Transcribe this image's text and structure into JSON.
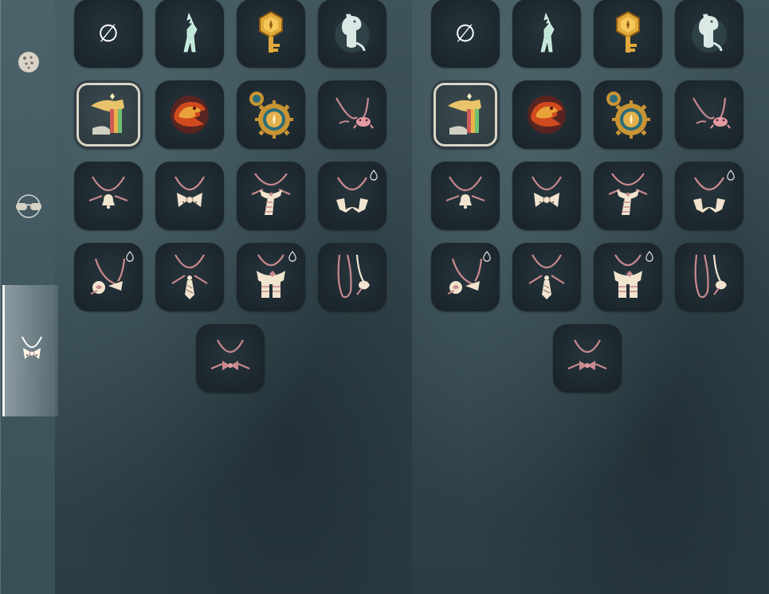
{
  "sidebar": {
    "tabs": [
      {
        "name": "cookie-tab",
        "icon": "cookie-icon"
      },
      {
        "name": "glasses-tab",
        "icon": "glasses-icon"
      },
      {
        "name": "necklace-tab",
        "icon": "bow-necklace-icon",
        "selected": true
      }
    ]
  },
  "grid": {
    "slots": [
      {
        "icon": "none-symbol-icon",
        "label": "∅"
      },
      {
        "icon": "deer-pendant-icon"
      },
      {
        "icon": "golden-key-icon"
      },
      {
        "icon": "moomin-pendant-icon"
      },
      {
        "icon": "rainbow-wing-icon",
        "selected": true
      },
      {
        "icon": "fire-bird-icon"
      },
      {
        "icon": "sun-gear-icon"
      },
      {
        "icon": "crab-necklace-icon"
      },
      {
        "icon": "bell-necklace-icon"
      },
      {
        "icon": "bow-necklace-icon"
      },
      {
        "icon": "scarf-necklace-icon"
      },
      {
        "icon": "ruffle-necklace-icon",
        "dye": true
      },
      {
        "icon": "rose-necklace-icon",
        "dye": true
      },
      {
        "icon": "tie-necklace-icon"
      },
      {
        "icon": "knit-scarf-icon",
        "dye": true
      },
      {
        "icon": "long-cord-icon"
      },
      {
        "icon": "small-bow-necklace-icon"
      }
    ]
  },
  "colors": {
    "cord": "#c98a8f",
    "accent_gold": "#e0a93a",
    "mint": "#bfe7d8",
    "cream": "#f1e4cf"
  }
}
